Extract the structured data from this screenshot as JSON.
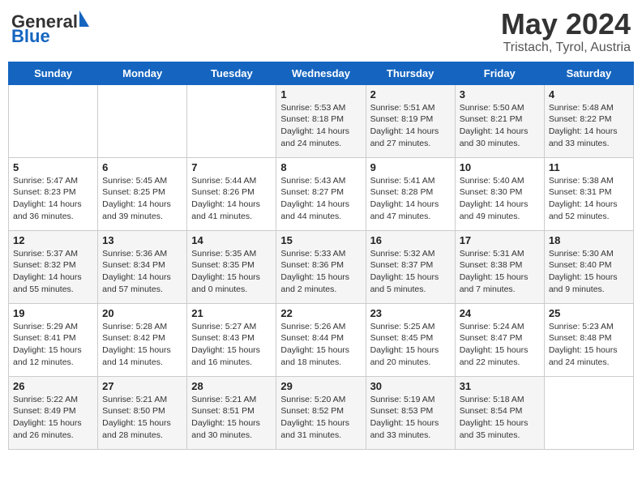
{
  "header": {
    "logo_general": "General",
    "logo_blue": "Blue",
    "month": "May 2024",
    "location": "Tristach, Tyrol, Austria"
  },
  "weekdays": [
    "Sunday",
    "Monday",
    "Tuesday",
    "Wednesday",
    "Thursday",
    "Friday",
    "Saturday"
  ],
  "weeks": [
    [
      {
        "day": "",
        "sunrise": "",
        "sunset": "",
        "daylight": ""
      },
      {
        "day": "",
        "sunrise": "",
        "sunset": "",
        "daylight": ""
      },
      {
        "day": "",
        "sunrise": "",
        "sunset": "",
        "daylight": ""
      },
      {
        "day": "1",
        "sunrise": "Sunrise: 5:53 AM",
        "sunset": "Sunset: 8:18 PM",
        "daylight": "Daylight: 14 hours and 24 minutes."
      },
      {
        "day": "2",
        "sunrise": "Sunrise: 5:51 AM",
        "sunset": "Sunset: 8:19 PM",
        "daylight": "Daylight: 14 hours and 27 minutes."
      },
      {
        "day": "3",
        "sunrise": "Sunrise: 5:50 AM",
        "sunset": "Sunset: 8:21 PM",
        "daylight": "Daylight: 14 hours and 30 minutes."
      },
      {
        "day": "4",
        "sunrise": "Sunrise: 5:48 AM",
        "sunset": "Sunset: 8:22 PM",
        "daylight": "Daylight: 14 hours and 33 minutes."
      }
    ],
    [
      {
        "day": "5",
        "sunrise": "Sunrise: 5:47 AM",
        "sunset": "Sunset: 8:23 PM",
        "daylight": "Daylight: 14 hours and 36 minutes."
      },
      {
        "day": "6",
        "sunrise": "Sunrise: 5:45 AM",
        "sunset": "Sunset: 8:25 PM",
        "daylight": "Daylight: 14 hours and 39 minutes."
      },
      {
        "day": "7",
        "sunrise": "Sunrise: 5:44 AM",
        "sunset": "Sunset: 8:26 PM",
        "daylight": "Daylight: 14 hours and 41 minutes."
      },
      {
        "day": "8",
        "sunrise": "Sunrise: 5:43 AM",
        "sunset": "Sunset: 8:27 PM",
        "daylight": "Daylight: 14 hours and 44 minutes."
      },
      {
        "day": "9",
        "sunrise": "Sunrise: 5:41 AM",
        "sunset": "Sunset: 8:28 PM",
        "daylight": "Daylight: 14 hours and 47 minutes."
      },
      {
        "day": "10",
        "sunrise": "Sunrise: 5:40 AM",
        "sunset": "Sunset: 8:30 PM",
        "daylight": "Daylight: 14 hours and 49 minutes."
      },
      {
        "day": "11",
        "sunrise": "Sunrise: 5:38 AM",
        "sunset": "Sunset: 8:31 PM",
        "daylight": "Daylight: 14 hours and 52 minutes."
      }
    ],
    [
      {
        "day": "12",
        "sunrise": "Sunrise: 5:37 AM",
        "sunset": "Sunset: 8:32 PM",
        "daylight": "Daylight: 14 hours and 55 minutes."
      },
      {
        "day": "13",
        "sunrise": "Sunrise: 5:36 AM",
        "sunset": "Sunset: 8:34 PM",
        "daylight": "Daylight: 14 hours and 57 minutes."
      },
      {
        "day": "14",
        "sunrise": "Sunrise: 5:35 AM",
        "sunset": "Sunset: 8:35 PM",
        "daylight": "Daylight: 15 hours and 0 minutes."
      },
      {
        "day": "15",
        "sunrise": "Sunrise: 5:33 AM",
        "sunset": "Sunset: 8:36 PM",
        "daylight": "Daylight: 15 hours and 2 minutes."
      },
      {
        "day": "16",
        "sunrise": "Sunrise: 5:32 AM",
        "sunset": "Sunset: 8:37 PM",
        "daylight": "Daylight: 15 hours and 5 minutes."
      },
      {
        "day": "17",
        "sunrise": "Sunrise: 5:31 AM",
        "sunset": "Sunset: 8:38 PM",
        "daylight": "Daylight: 15 hours and 7 minutes."
      },
      {
        "day": "18",
        "sunrise": "Sunrise: 5:30 AM",
        "sunset": "Sunset: 8:40 PM",
        "daylight": "Daylight: 15 hours and 9 minutes."
      }
    ],
    [
      {
        "day": "19",
        "sunrise": "Sunrise: 5:29 AM",
        "sunset": "Sunset: 8:41 PM",
        "daylight": "Daylight: 15 hours and 12 minutes."
      },
      {
        "day": "20",
        "sunrise": "Sunrise: 5:28 AM",
        "sunset": "Sunset: 8:42 PM",
        "daylight": "Daylight: 15 hours and 14 minutes."
      },
      {
        "day": "21",
        "sunrise": "Sunrise: 5:27 AM",
        "sunset": "Sunset: 8:43 PM",
        "daylight": "Daylight: 15 hours and 16 minutes."
      },
      {
        "day": "22",
        "sunrise": "Sunrise: 5:26 AM",
        "sunset": "Sunset: 8:44 PM",
        "daylight": "Daylight: 15 hours and 18 minutes."
      },
      {
        "day": "23",
        "sunrise": "Sunrise: 5:25 AM",
        "sunset": "Sunset: 8:45 PM",
        "daylight": "Daylight: 15 hours and 20 minutes."
      },
      {
        "day": "24",
        "sunrise": "Sunrise: 5:24 AM",
        "sunset": "Sunset: 8:47 PM",
        "daylight": "Daylight: 15 hours and 22 minutes."
      },
      {
        "day": "25",
        "sunrise": "Sunrise: 5:23 AM",
        "sunset": "Sunset: 8:48 PM",
        "daylight": "Daylight: 15 hours and 24 minutes."
      }
    ],
    [
      {
        "day": "26",
        "sunrise": "Sunrise: 5:22 AM",
        "sunset": "Sunset: 8:49 PM",
        "daylight": "Daylight: 15 hours and 26 minutes."
      },
      {
        "day": "27",
        "sunrise": "Sunrise: 5:21 AM",
        "sunset": "Sunset: 8:50 PM",
        "daylight": "Daylight: 15 hours and 28 minutes."
      },
      {
        "day": "28",
        "sunrise": "Sunrise: 5:21 AM",
        "sunset": "Sunset: 8:51 PM",
        "daylight": "Daylight: 15 hours and 30 minutes."
      },
      {
        "day": "29",
        "sunrise": "Sunrise: 5:20 AM",
        "sunset": "Sunset: 8:52 PM",
        "daylight": "Daylight: 15 hours and 31 minutes."
      },
      {
        "day": "30",
        "sunrise": "Sunrise: 5:19 AM",
        "sunset": "Sunset: 8:53 PM",
        "daylight": "Daylight: 15 hours and 33 minutes."
      },
      {
        "day": "31",
        "sunrise": "Sunrise: 5:18 AM",
        "sunset": "Sunset: 8:54 PM",
        "daylight": "Daylight: 15 hours and 35 minutes."
      },
      {
        "day": "",
        "sunrise": "",
        "sunset": "",
        "daylight": ""
      }
    ]
  ]
}
